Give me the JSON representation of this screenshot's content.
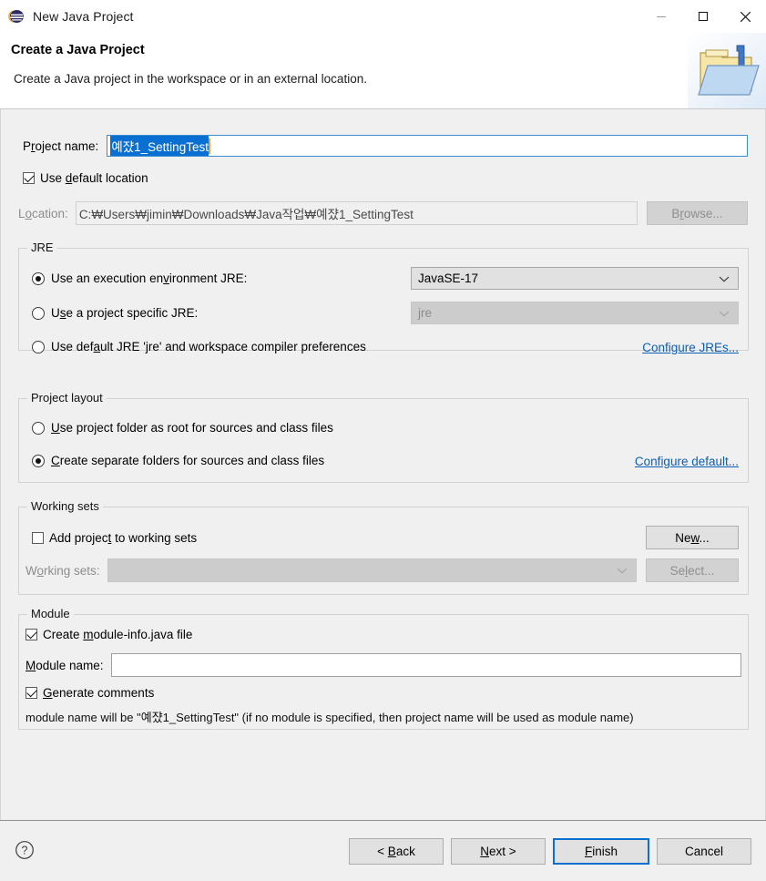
{
  "window": {
    "title": "New Java Project",
    "icon": "eclipse-logo-icon",
    "minimize_label": "–",
    "maximize_label": "□",
    "close_label": "✕"
  },
  "banner": {
    "title": "Create a Java Project",
    "description": "Create a Java project in the workspace or in an external location.",
    "icon": "java-project-folder-icon"
  },
  "project_name": {
    "label_pre": "P",
    "label_mnemonic": "r",
    "label_post": "oject name:",
    "label_full": "Project name:",
    "value": "예쟜1_SettingTest",
    "selected": true
  },
  "location": {
    "use_default_label_pre": "Use ",
    "use_default_mnemonic": "d",
    "use_default_label_post": "efault location",
    "use_default_label_full": "Use default location",
    "use_default_checked": true,
    "label_pre": "L",
    "label_mnemonic": "o",
    "label_post": "cation:",
    "label_full": "Location:",
    "value": "C:₩Users₩jimin₩Downloads₩Java작업₩예쟜1_SettingTest",
    "browse_label_pre": "B",
    "browse_mnemonic": "r",
    "browse_label_post": "owse...",
    "browse_label_full": "Browse...",
    "browse_enabled": false
  },
  "jre": {
    "group_title": "JRE",
    "options": [
      {
        "label_pre": "Use an execution en",
        "mnemonic": "v",
        "label_post": "ironment JRE:",
        "label_full": "Use an execution environment JRE:",
        "selected": true
      },
      {
        "label_pre": "U",
        "mnemonic": "s",
        "label_post": "e a project specific JRE:",
        "label_full": "Use a project specific JRE:",
        "selected": false
      },
      {
        "label_pre": "Use def",
        "mnemonic": "a",
        "label_post": "ult JRE 'jre' and workspace compiler preferences",
        "label_full": "Use default JRE 'jre' and workspace compiler preferences",
        "selected": false
      }
    ],
    "execution_env_value": "JavaSE-17",
    "execution_env_enabled": true,
    "project_jre_value": "jre",
    "project_jre_enabled": false,
    "configure_link": "Configure JREs..."
  },
  "project_layout": {
    "group_title": "Project layout",
    "options": [
      {
        "label_pre": "",
        "mnemonic": "U",
        "label_post": "se project folder as root for sources and class files",
        "label_full": "Use project folder as root for sources and class files",
        "selected": false
      },
      {
        "label_pre": "",
        "mnemonic": "C",
        "label_post": "reate separate folders for sources and class files",
        "label_full": "Create separate folders for sources and class files",
        "selected": true
      }
    ],
    "configure_link": "Configure default..."
  },
  "working_sets": {
    "group_title": "Working sets",
    "add_label_pre": "Add projec",
    "add_mnemonic": "t",
    "add_label_post": " to working sets",
    "add_label_full": "Add project to working sets",
    "add_checked": false,
    "new_label_pre": "Ne",
    "new_mnemonic": "w",
    "new_label_post": "...",
    "new_label_full": "New...",
    "new_enabled": true,
    "sets_label_pre": "W",
    "sets_mnemonic": "o",
    "sets_label_post": "rking sets:",
    "sets_label_full": "Working sets:",
    "sets_value": "",
    "sets_enabled": false,
    "select_label_pre": "Se",
    "select_mnemonic": "l",
    "select_label_post": "ect...",
    "select_label_full": "Select...",
    "select_enabled": false
  },
  "module": {
    "group_title": "Module",
    "create_label_pre": "Create ",
    "create_mnemonic": "m",
    "create_label_post": "odule-info.java file",
    "create_label_full": "Create module-info.java file",
    "create_checked": true,
    "name_label_pre": "",
    "name_mnemonic": "M",
    "name_label_post": "odule name:",
    "name_label_full": "Module name:",
    "name_value": "",
    "comments_label_pre": "",
    "comments_mnemonic": "G",
    "comments_label_post": "enerate comments",
    "comments_label_full": "Generate comments",
    "comments_checked": true,
    "hint": "module name will be \"예쟜1_SettingTest\"  (if no module is specified, then project name will be used as module name)"
  },
  "footer": {
    "help_icon": "help-question-icon",
    "back_label_pre": "< ",
    "back_mnemonic": "B",
    "back_label_post": "ack",
    "back_label_full": "< Back",
    "next_label_pre": "",
    "next_mnemonic": "N",
    "next_label_post": "ext >",
    "next_label_full": "Next >",
    "finish_label_pre": "",
    "finish_mnemonic": "F",
    "finish_label_post": "inish",
    "finish_label_full": "Finish",
    "finish_is_default": true,
    "cancel_label": "Cancel"
  },
  "colors": {
    "accent": "#0a70d0",
    "selection": "#0a6fd2",
    "link": "#0b5fb5",
    "dialog_bg": "#f0f0f0",
    "caret": "#e8a33d"
  }
}
